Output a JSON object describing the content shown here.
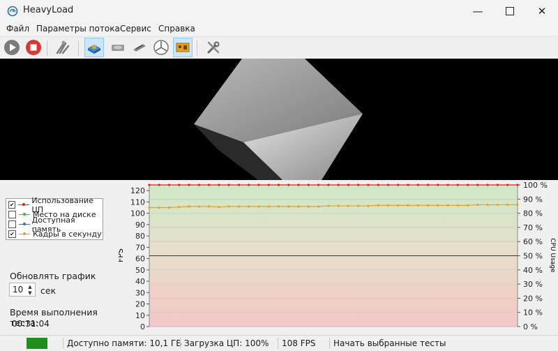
{
  "window": {
    "title": "HeavyLoad"
  },
  "menu": [
    "Файл",
    "Параметры потока",
    "Сервис",
    "Справка"
  ],
  "toolbar_icons": [
    "play-icon",
    "stop-icon",
    "toolbox-icon",
    "cpu-icon",
    "hard-disk-icon",
    "memory-icon",
    "fan-icon",
    "gpu-icon",
    "settings-icon"
  ],
  "legend": [
    {
      "label": "Использование ЦП",
      "checked": true,
      "color": "#e02020"
    },
    {
      "label": "Место на диске",
      "checked": false,
      "color": "#2fbf2f"
    },
    {
      "label": "Доступная память",
      "checked": false,
      "color": "#2f6fdf"
    },
    {
      "label": "Кадры в секунду",
      "checked": true,
      "color": "#e8a020"
    }
  ],
  "controls": {
    "refresh_label": "Обновлять график через",
    "refresh_value": "10",
    "refresh_unit": "сек",
    "elapsed_label": "Время выполнения теста:",
    "elapsed_value": "00:31:04"
  },
  "chart_data": {
    "type": "line",
    "ylabel": "FPS",
    "y2label": "CPU Usage",
    "ylim": [
      0,
      125
    ],
    "y2lim": [
      0,
      100
    ],
    "yticks": [
      "120",
      "110",
      "100",
      "90",
      "80",
      "70",
      "60",
      "50",
      "40",
      "30",
      "20",
      "10",
      "0"
    ],
    "y2ticks": [
      "100 %",
      "90 %",
      "80 %",
      "70 %",
      "60 %",
      "50 %",
      "40 %",
      "30 %",
      "20 %",
      "10 %",
      "0 %"
    ],
    "series": [
      {
        "name": "Использование ЦП",
        "color": "#e02020",
        "axis": "y2",
        "values": [
          100,
          100,
          100,
          100,
          100,
          100,
          100,
          100,
          100,
          100,
          100,
          100,
          100,
          100,
          100,
          100,
          100,
          100,
          100,
          100,
          100,
          100,
          100,
          100,
          100,
          100,
          100,
          100,
          100,
          100,
          100,
          100,
          100,
          100,
          100,
          100,
          100,
          100
        ]
      },
      {
        "name": "Кадры в секунду",
        "color": "#e8a020",
        "axis": "y",
        "values": [
          105,
          105,
          105,
          105.5,
          106,
          106,
          106,
          105.5,
          106,
          106,
          106,
          106,
          106,
          106,
          106,
          106,
          106,
          106,
          106.5,
          106.5,
          106.5,
          106.5,
          106.5,
          107,
          107,
          107,
          107,
          107,
          107,
          107,
          107,
          107,
          107,
          107.5,
          107.5,
          107.5,
          107.5,
          107.5
        ]
      }
    ]
  },
  "status": {
    "memory": "Доступно памяти: 10,1 ГБ",
    "cpu": "Загрузка ЦП: 100%",
    "fps": "108 FPS",
    "message": "Начать выбранные тесты"
  }
}
